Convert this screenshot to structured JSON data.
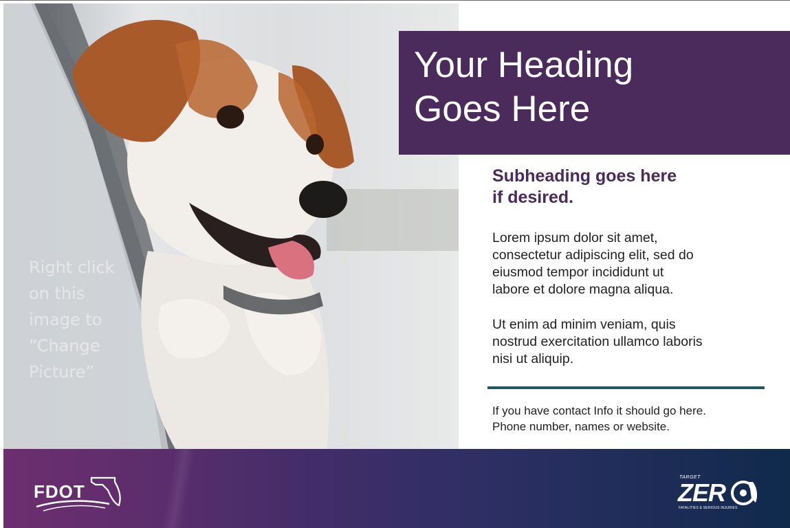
{
  "heading": {
    "line1": "Your Heading",
    "line2": "Goes Here"
  },
  "subheading": {
    "line1": "Subheading goes here",
    "line2": "if desired."
  },
  "body": {
    "paragraph1": [
      "Lorem ipsum dolor sit amet,",
      "consectetur adipiscing elit, sed do",
      "eiusmod tempor incididunt ut",
      "labore et dolore magna aliqua."
    ],
    "paragraph2": [
      "Ut enim ad minim veniam, quis",
      "nostrud exercitation ullamco laboris",
      "nisi ut aliquip."
    ]
  },
  "contact": [
    "If you have contact Info it should go here.",
    "Phone number, names or website."
  ],
  "photo_hint": [
    "Right click",
    "on this",
    "image to",
    "“Change",
    "Picture”"
  ],
  "footer": {
    "fdot_logo": "FDOT",
    "target_zero": {
      "small": "TARGET",
      "main": "ZER",
      "tagline": "FATALITIES & SERIOUS INJURIES"
    }
  },
  "colors": {
    "purple": "#4b2a5c",
    "teal_rule": "#225562",
    "footer_left": "#6c2f6f",
    "footer_right": "#102a4c"
  },
  "icons": {
    "photo": "dog-photo",
    "fdot": "florida-state-icon",
    "tz": "steering-wheel-icon"
  }
}
